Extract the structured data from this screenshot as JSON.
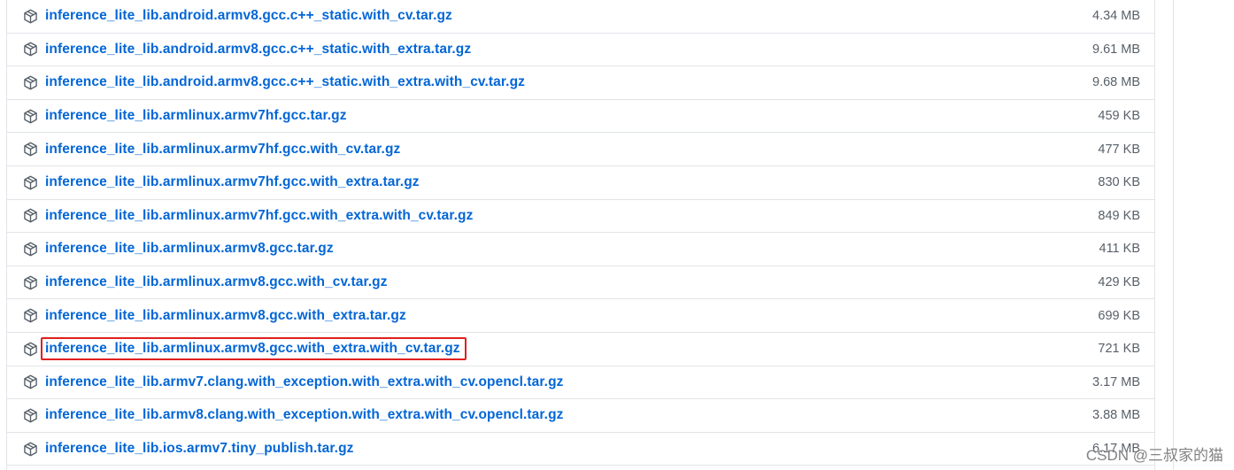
{
  "colors": {
    "link": "#0366d6",
    "size_text": "#586069",
    "border": "#e1e4e8",
    "highlight": "#e02020"
  },
  "assets": [
    {
      "name": "inference_lite_lib.android.armv8.gcc.c++_static.with_cv.tar.gz",
      "size": "4.34 MB",
      "icon": "package-icon",
      "highlighted": false
    },
    {
      "name": "inference_lite_lib.android.armv8.gcc.c++_static.with_extra.tar.gz",
      "size": "9.61 MB",
      "icon": "package-icon",
      "highlighted": false
    },
    {
      "name": "inference_lite_lib.android.armv8.gcc.c++_static.with_extra.with_cv.tar.gz",
      "size": "9.68 MB",
      "icon": "package-icon",
      "highlighted": false
    },
    {
      "name": "inference_lite_lib.armlinux.armv7hf.gcc.tar.gz",
      "size": "459 KB",
      "icon": "package-icon",
      "highlighted": false
    },
    {
      "name": "inference_lite_lib.armlinux.armv7hf.gcc.with_cv.tar.gz",
      "size": "477 KB",
      "icon": "package-icon",
      "highlighted": false
    },
    {
      "name": "inference_lite_lib.armlinux.armv7hf.gcc.with_extra.tar.gz",
      "size": "830 KB",
      "icon": "package-icon",
      "highlighted": false
    },
    {
      "name": "inference_lite_lib.armlinux.armv7hf.gcc.with_extra.with_cv.tar.gz",
      "size": "849 KB",
      "icon": "package-icon",
      "highlighted": false
    },
    {
      "name": "inference_lite_lib.armlinux.armv8.gcc.tar.gz",
      "size": "411 KB",
      "icon": "package-icon",
      "highlighted": false
    },
    {
      "name": "inference_lite_lib.armlinux.armv8.gcc.with_cv.tar.gz",
      "size": "429 KB",
      "icon": "package-icon",
      "highlighted": false
    },
    {
      "name": "inference_lite_lib.armlinux.armv8.gcc.with_extra.tar.gz",
      "size": "699 KB",
      "icon": "package-icon",
      "highlighted": false
    },
    {
      "name": "inference_lite_lib.armlinux.armv8.gcc.with_extra.with_cv.tar.gz",
      "size": "721 KB",
      "icon": "package-icon",
      "highlighted": true
    },
    {
      "name": "inference_lite_lib.armv7.clang.with_exception.with_extra.with_cv.opencl.tar.gz",
      "size": "3.17 MB",
      "icon": "package-icon",
      "highlighted": false
    },
    {
      "name": "inference_lite_lib.armv8.clang.with_exception.with_extra.with_cv.opencl.tar.gz",
      "size": "3.88 MB",
      "icon": "package-icon",
      "highlighted": false
    },
    {
      "name": "inference_lite_lib.ios.armv7.tiny_publish.tar.gz",
      "size": "6.17 MB",
      "icon": "package-icon",
      "highlighted": false
    }
  ],
  "watermark": "CSDN @三叔家的猫"
}
